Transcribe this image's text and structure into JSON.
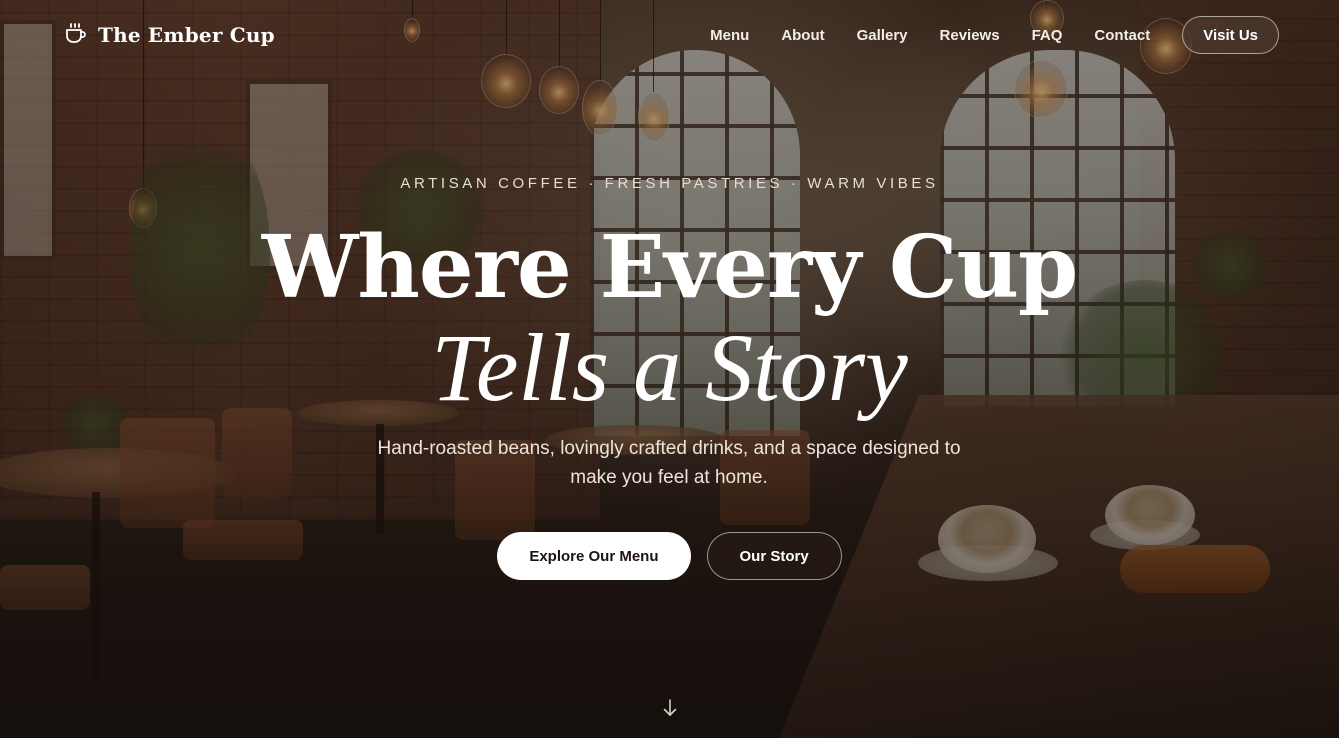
{
  "brand": {
    "name": "The Ember Cup",
    "icon": "coffee-cup-icon"
  },
  "nav": {
    "links": [
      "Menu",
      "About",
      "Gallery",
      "Reviews",
      "FAQ",
      "Contact"
    ],
    "cta_label": "Visit Us"
  },
  "hero": {
    "tagline": "ARTISAN COFFEE · FRESH PASTRIES · WARM VIBES",
    "headline": "Where Every Cup",
    "headline_italic": "Tells a Story",
    "subtext": "Hand-roasted beans, lovingly crafted drinks, and a space designed to make you feel at home.",
    "primary_button": "Explore Our Menu",
    "secondary_button": "Our Story",
    "scroll_icon": "arrow-down-icon"
  },
  "colors": {
    "overlay": "#140c08",
    "primary_button_bg": "#ffffff",
    "primary_button_text": "#1d1410"
  }
}
